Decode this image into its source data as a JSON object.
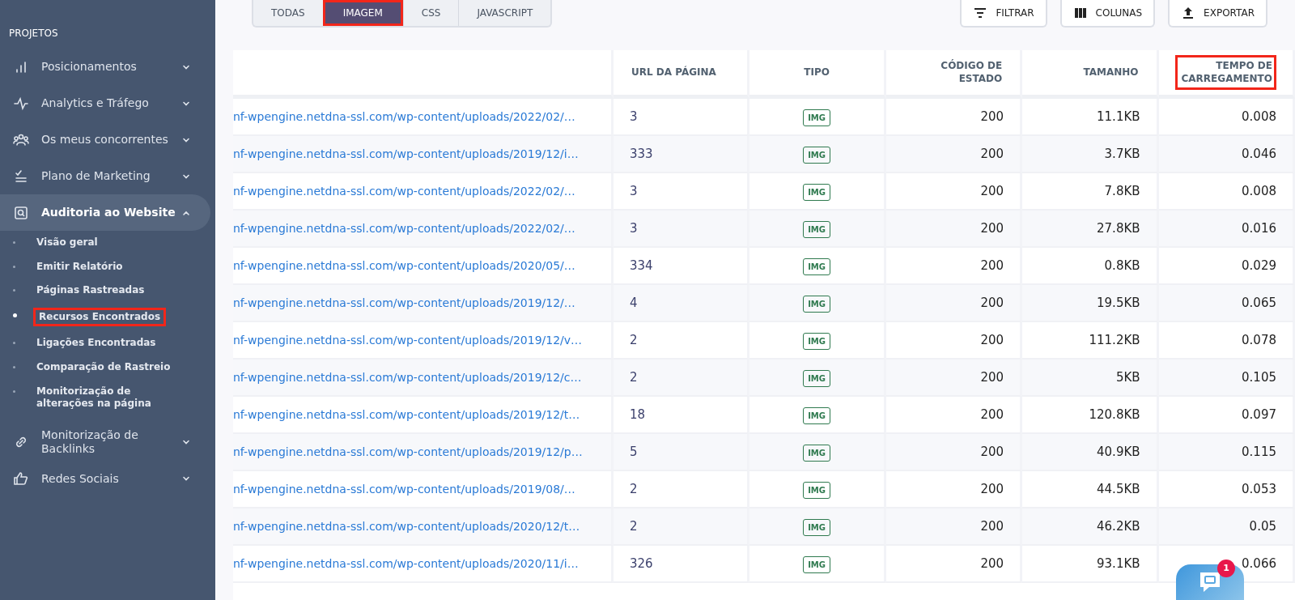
{
  "sidebar": {
    "section_title": "PROJETOS",
    "items": [
      {
        "label": "Posicionamentos",
        "expanded": false
      },
      {
        "label": "Analytics e Tráfego",
        "expanded": false
      },
      {
        "label": "Os meus concorrentes",
        "expanded": false
      },
      {
        "label": "Plano de Marketing",
        "expanded": false
      },
      {
        "label": "Auditoria ao Website",
        "expanded": true,
        "children": [
          {
            "label": "Visão geral",
            "selected": false,
            "highlighted": false
          },
          {
            "label": "Emitir Relatório",
            "selected": false,
            "highlighted": false
          },
          {
            "label": "Páginas Rastreadas",
            "selected": false,
            "highlighted": false
          },
          {
            "label": "Recursos Encontrados",
            "selected": true,
            "highlighted": true
          },
          {
            "label": "Ligações Encontradas",
            "selected": false,
            "highlighted": false
          },
          {
            "label": "Comparação de Rastreio",
            "selected": false,
            "highlighted": false
          },
          {
            "label": "Monitorização de alterações na página",
            "selected": false,
            "highlighted": false
          }
        ]
      },
      {
        "label": "Monitorização de Backlinks",
        "expanded": false
      },
      {
        "label": "Redes Sociais",
        "expanded": false
      }
    ]
  },
  "tabs": [
    {
      "label": "TODAS",
      "selected": false,
      "highlighted": false
    },
    {
      "label": "IMAGEM",
      "selected": true,
      "highlighted": true
    },
    {
      "label": "CSS",
      "selected": false,
      "highlighted": false
    },
    {
      "label": "JAVASCRIPT",
      "selected": false,
      "highlighted": false
    }
  ],
  "actions": [
    {
      "label": "FILTRAR"
    },
    {
      "label": "COLUNAS"
    },
    {
      "label": "EXPORTAR"
    }
  ],
  "table": {
    "columns": [
      {
        "highlighted": false
      },
      {
        "label": "URL DA PÁGINA",
        "highlighted": false
      },
      {
        "label": "TIPO",
        "highlighted": false
      },
      {
        "label": "CÓDIGO DE ESTADO",
        "highlighted": false
      },
      {
        "label": "TAMANHO",
        "highlighted": false
      },
      {
        "label": "TEMPO DE CARREGAMENTO",
        "highlighted": true
      }
    ],
    "rows": [
      [
        "nf-wpengine.netdna-ssl.com/wp-content/uploads/2022/02/…",
        "3",
        "IMG",
        "200",
        "11.1KB",
        "0.008"
      ],
      [
        "nf-wpengine.netdna-ssl.com/wp-content/uploads/2019/12/i…",
        "333",
        "IMG",
        "200",
        "3.7KB",
        "0.046"
      ],
      [
        "nf-wpengine.netdna-ssl.com/wp-content/uploads/2022/02/…",
        "3",
        "IMG",
        "200",
        "7.8KB",
        "0.008"
      ],
      [
        "nf-wpengine.netdna-ssl.com/wp-content/uploads/2022/02/…",
        "3",
        "IMG",
        "200",
        "27.8KB",
        "0.016"
      ],
      [
        "nf-wpengine.netdna-ssl.com/wp-content/uploads/2020/05/…",
        "334",
        "IMG",
        "200",
        "0.8KB",
        "0.029"
      ],
      [
        "nf-wpengine.netdna-ssl.com/wp-content/uploads/2019/12/…",
        "4",
        "IMG",
        "200",
        "19.5KB",
        "0.065"
      ],
      [
        "nf-wpengine.netdna-ssl.com/wp-content/uploads/2019/12/v…",
        "2",
        "IMG",
        "200",
        "111.2KB",
        "0.078"
      ],
      [
        "nf-wpengine.netdna-ssl.com/wp-content/uploads/2019/12/c…",
        "2",
        "IMG",
        "200",
        "5KB",
        "0.105"
      ],
      [
        "nf-wpengine.netdna-ssl.com/wp-content/uploads/2019/12/t…",
        "18",
        "IMG",
        "200",
        "120.8KB",
        "0.097"
      ],
      [
        "nf-wpengine.netdna-ssl.com/wp-content/uploads/2019/12/p…",
        "5",
        "IMG",
        "200",
        "40.9KB",
        "0.115"
      ],
      [
        "nf-wpengine.netdna-ssl.com/wp-content/uploads/2019/08/…",
        "2",
        "IMG",
        "200",
        "44.5KB",
        "0.053"
      ],
      [
        "nf-wpengine.netdna-ssl.com/wp-content/uploads/2020/12/t…",
        "2",
        "IMG",
        "200",
        "46.2KB",
        "0.05"
      ],
      [
        "nf-wpengine.netdna-ssl.com/wp-content/uploads/2020/11/i…",
        "326",
        "IMG",
        "200",
        "93.1KB",
        "0.066"
      ]
    ]
  },
  "chat": {
    "badge": "1"
  }
}
